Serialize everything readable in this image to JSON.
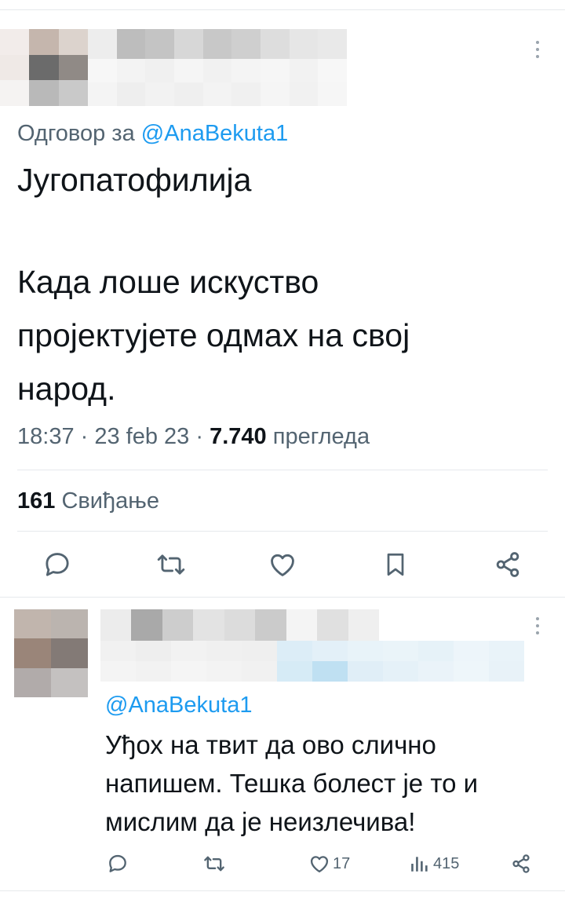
{
  "tweet": {
    "reply_prefix": "Одговор за",
    "reply_handle": "@AnaBekuta1",
    "body_lines": [
      "Југопатофилија",
      "Када лоше искуство",
      "пројектујете одмах на свој",
      "народ."
    ],
    "meta": {
      "time": "18:37",
      "date": "23 feb 23",
      "views_count": "7.740",
      "views_label": "прегледа"
    },
    "likes": {
      "count": "161",
      "label": "Свиђање"
    },
    "actions": [
      "reply-icon",
      "retweet-icon",
      "like-icon",
      "bookmark-icon",
      "share-icon"
    ]
  },
  "reply": {
    "handle": "@AnaBekuta1",
    "body_lines": [
      "Уђох на твит да ово слично",
      "напишем. Тешка болест је то и",
      "мислим да је неизлечива!"
    ],
    "likes_count": "17",
    "views_count": "415",
    "actions": [
      "reply-icon",
      "retweet-icon",
      "like-icon",
      "views-icon",
      "share-icon"
    ]
  },
  "colors": {
    "text": "#0f1419",
    "muted": "#536471",
    "link": "#1d9bf0",
    "divider": "#e6e9ec"
  }
}
